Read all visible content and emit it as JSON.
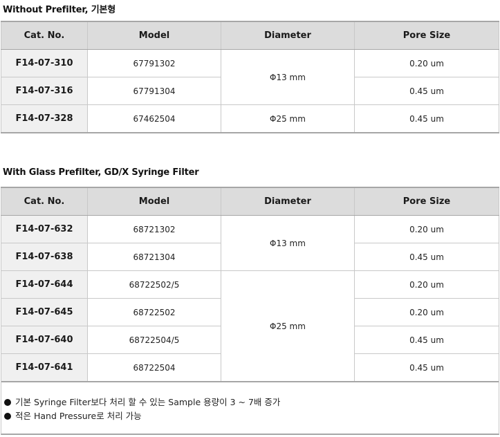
{
  "sections": [
    {
      "title": "Without Prefilter, 기본형",
      "headers": [
        "Cat. No.",
        "Model",
        "Diameter",
        "Pore Size"
      ],
      "rows": [
        {
          "cat": "F14-07-310",
          "model": "67791302",
          "diameter": "Φ13 mm",
          "pore": "0.20 um"
        },
        {
          "cat": "F14-07-316",
          "model": "67791304",
          "diameter": "Φ13 mm",
          "pore": "0.45 um"
        },
        {
          "cat": "F14-07-328",
          "model": "67462504",
          "diameter": "Φ25 mm",
          "pore": "0.45 um"
        }
      ]
    },
    {
      "title": "With Glass Prefilter, GD/X Syringe Filter",
      "headers": [
        "Cat. No.",
        "Model",
        "Diameter",
        "Pore Size"
      ],
      "rows": [
        {
          "cat": "F14-07-632",
          "model": "68721302",
          "diameter": "Φ13 mm",
          "pore": "0.20 um"
        },
        {
          "cat": "F14-07-638",
          "model": "68721304",
          "diameter": "Φ13 mm",
          "pore": "0.45 um"
        },
        {
          "cat": "F14-07-644",
          "model": "68722502/5",
          "diameter": "Φ25 mm",
          "pore": "0.20 um"
        },
        {
          "cat": "F14-07-645",
          "model": "68722502",
          "diameter": "Φ25 mm",
          "pore": "0.20 um"
        },
        {
          "cat": "F14-07-640",
          "model": "68722504/5",
          "diameter": "Φ25 mm",
          "pore": "0.45 um"
        },
        {
          "cat": "F14-07-641",
          "model": "68722504",
          "diameter": "Φ25 mm",
          "pore": "0.45 um"
        }
      ]
    }
  ],
  "notes": [
    "기본 Syringe Filter보다 처리 할 수 있는 Sample 용량이 3 ~ 7배 증가",
    "적은 Hand Pressure로 처리 가능"
  ]
}
